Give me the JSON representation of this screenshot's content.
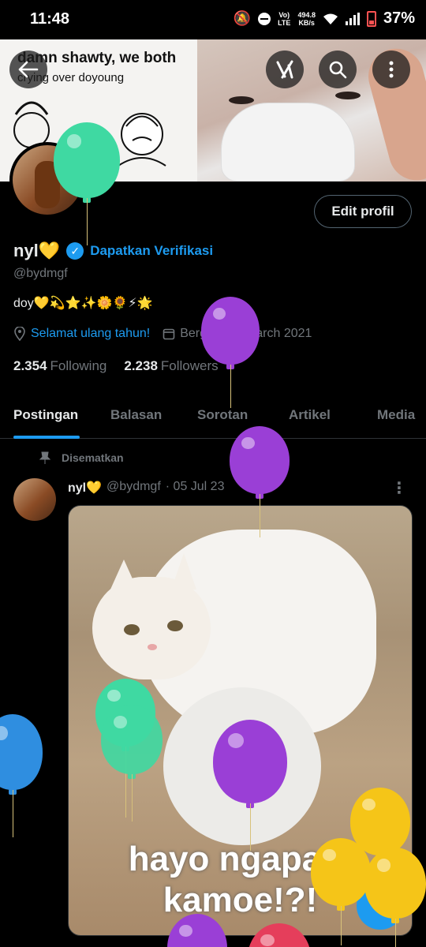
{
  "status_bar": {
    "time": "11:48",
    "net_speed_value": "494.8",
    "net_speed_unit": "KB/s",
    "network_type": "LTE",
    "battery": "37%",
    "icons": [
      "mute-icon",
      "dnd-icon",
      "volte-icon",
      "wifi-icon",
      "signal-icon",
      "battery-icon"
    ]
  },
  "banner": {
    "meme_text": "damn shawty, we both",
    "meme_subtext": "crying over doyoung"
  },
  "top_actions": {
    "back_icon": "back-arrow-icon",
    "grok_icon": "grok-icon",
    "search_icon": "search-icon",
    "more_icon": "more-vertical-icon"
  },
  "profile": {
    "edit_button": "Edit profil",
    "display_name": "nyl💛",
    "verify_link": "Dapatkan Verifikasi",
    "handle": "@bydmgf",
    "bio": "doy💛💫⭐✨🌼🌻⚡🌟",
    "birthday_text": "Selamat ulang tahun!",
    "joined_text": "Bergabung March 2021",
    "following_count": "2.354",
    "following_label": "Following",
    "followers_count": "2.238",
    "followers_label": "Followers"
  },
  "tabs": [
    "Postingan",
    "Balasan",
    "Sorotan",
    "Artikel",
    "Media"
  ],
  "active_tab": "Postingan",
  "post": {
    "pinned_label": "Disematkan",
    "author": "nyl💛",
    "handle": "@bydmgf",
    "date": "· 05 Jul 23",
    "image_caption_line1": "hayo ngapain",
    "image_caption_line2": "kamoe!?!"
  },
  "fab": {
    "icon": "plus-icon",
    "label": "+"
  },
  "colors": {
    "accent": "#1d9bf0",
    "background": "#000000",
    "muted_text": "#71767b",
    "balloon_green": "#3fd9a2",
    "balloon_purple": "#9a3fd6",
    "balloon_blue": "#2f8ee0",
    "balloon_yellow": "#f5c518",
    "balloon_red": "#e53e5b"
  }
}
